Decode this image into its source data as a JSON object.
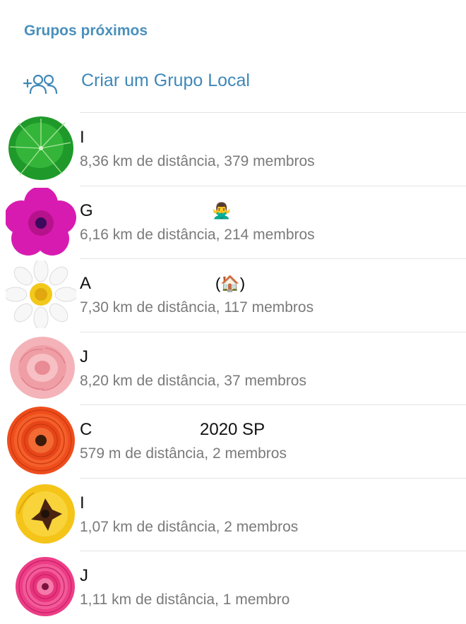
{
  "header": {
    "title": "Grupos próximos"
  },
  "create_group": {
    "label": "Criar um Grupo Local",
    "icon": "add-group-icon"
  },
  "accent_color": "#4a90bb",
  "groups": [
    {
      "name": "I",
      "subtitle": "8,36 km de distância, 379 membros",
      "avatar": "green-leaf"
    },
    {
      "name": "G",
      "emoji": "🙅‍♂️",
      "subtitle": "6,16 km de distância, 214 membros",
      "avatar": "magenta-petunia"
    },
    {
      "name": "A",
      "emoji": "(🏠)",
      "subtitle": "7,30 km de distância, 117 membros",
      "avatar": "white-daisy"
    },
    {
      "name": "J",
      "subtitle": "8,20 km de distância, 37 membros",
      "avatar": "pink-rose"
    },
    {
      "name": "C",
      "suffix": "2020 SP",
      "subtitle": "579 m de distância, 2 membros",
      "avatar": "orange-ranunculus"
    },
    {
      "name": "I",
      "subtitle": "1,07 km de distância, 2 membros",
      "avatar": "yellow-tulip"
    },
    {
      "name": "J",
      "subtitle": "1,11 km de distância, 1 membro",
      "avatar": "pink-ranunculus"
    }
  ]
}
